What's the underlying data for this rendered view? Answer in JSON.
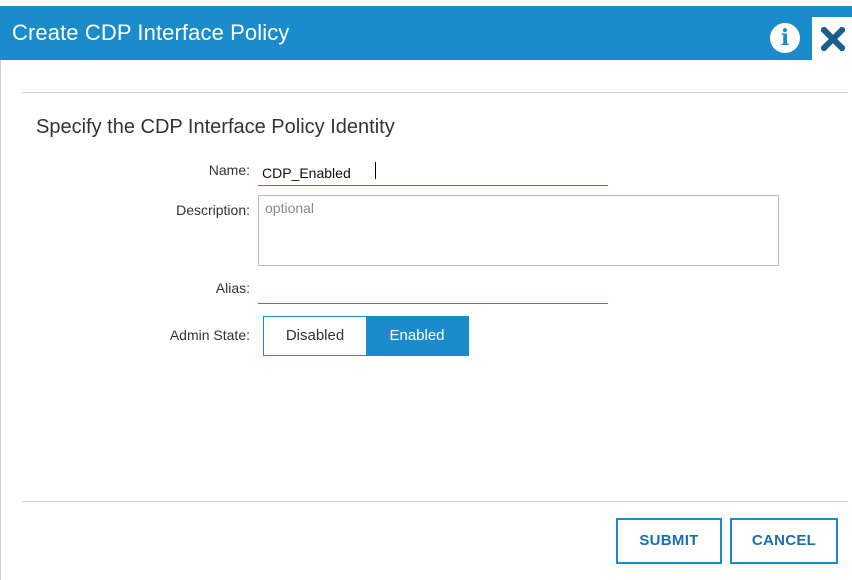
{
  "dialog": {
    "title": "Create CDP Interface Policy",
    "info_icon": "info-icon",
    "close_icon": "close-icon",
    "section_title": "Specify the CDP Interface Policy Identity"
  },
  "form": {
    "name_label": "Name:",
    "name_value": "CDP_Enabled",
    "description_label": "Description:",
    "description_placeholder": "optional",
    "description_value": "",
    "alias_label": "Alias:",
    "alias_value": "",
    "admin_state_label": "Admin State:",
    "admin_state_options": [
      "Disabled",
      "Enabled"
    ],
    "admin_state_selected": "Enabled"
  },
  "footer": {
    "submit_label": "SUBMIT",
    "cancel_label": "CANCEL"
  },
  "colors": {
    "accent": "#1a8ccb",
    "title_text": "#ffffff",
    "border": "#bdbdbd"
  }
}
